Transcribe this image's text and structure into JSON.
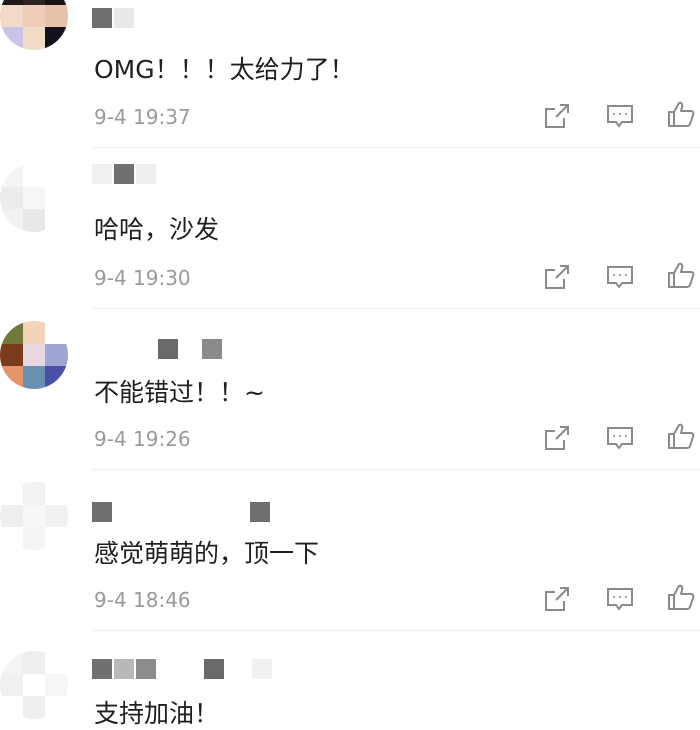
{
  "comments": [
    {
      "text": "OMG！！！太给力了！",
      "time": "9-4 19:37"
    },
    {
      "text": "哈哈，沙发",
      "time": "9-4 19:30"
    },
    {
      "text": "不能错过！！~",
      "time": "9-4 19:26"
    },
    {
      "text": "感觉萌萌的，顶一下",
      "time": "9-4 18:46"
    },
    {
      "text": "支持加油！",
      "time": ""
    }
  ],
  "icons": {
    "share": "share-icon",
    "reply": "comment-icon",
    "like": "thumbs-up-icon"
  },
  "colors": {
    "text": "#1f1f1f",
    "meta": "#9a9a9a",
    "icon": "#8a8a8a",
    "divider": "#eeeeee"
  }
}
